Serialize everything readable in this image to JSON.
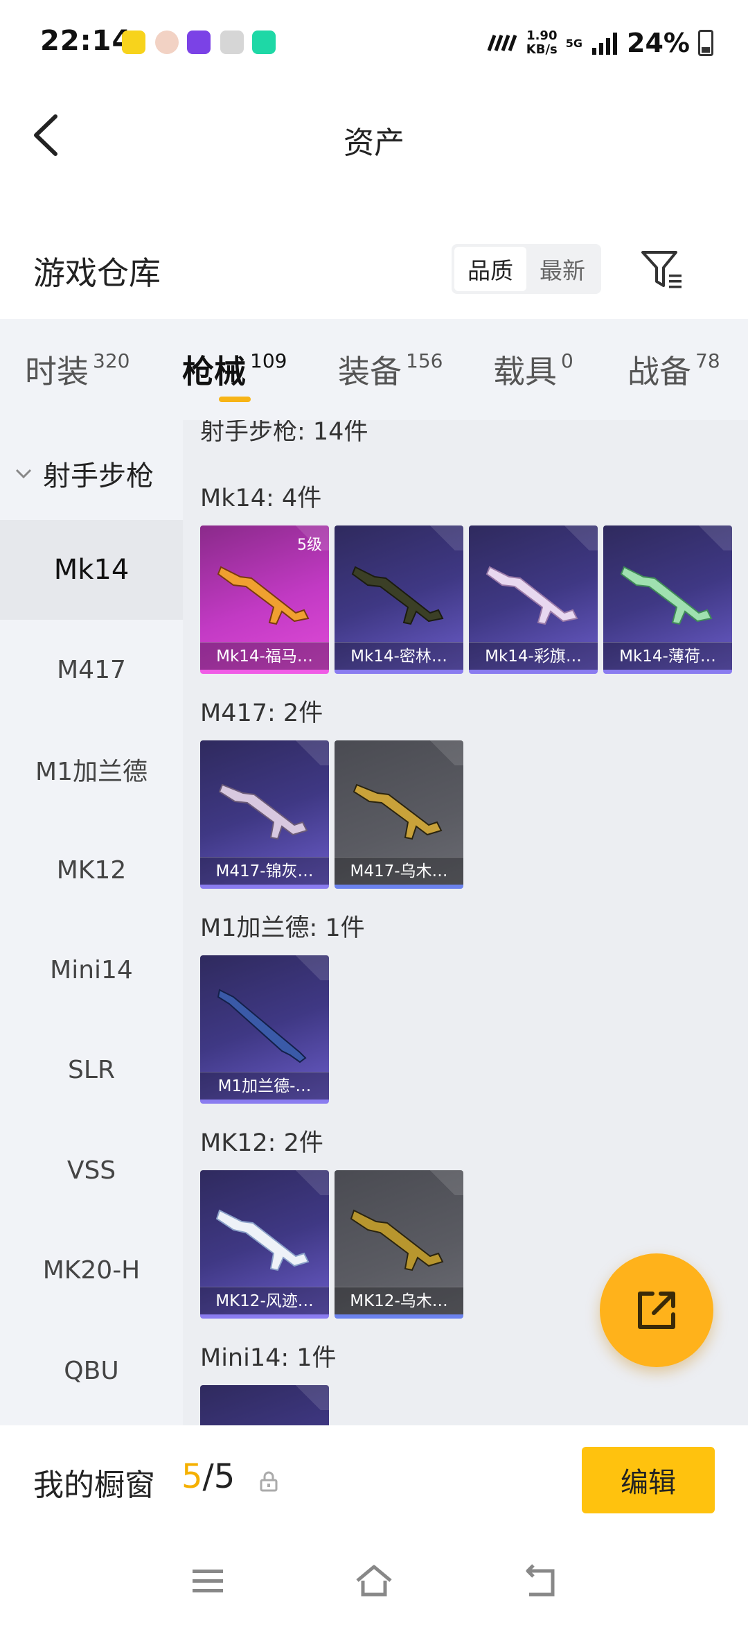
{
  "status": {
    "time": "22:14",
    "speed_top": "1.90",
    "speed_unit": "KB/s",
    "network": "5G",
    "battery": "24%"
  },
  "header": {
    "title": "资产"
  },
  "warehouse": {
    "title": "游戏仓库",
    "sort_quality": "品质",
    "sort_newest": "最新"
  },
  "tabs": [
    {
      "label": "时装",
      "count": "320"
    },
    {
      "label": "枪械",
      "count": "109"
    },
    {
      "label": "装备",
      "count": "156"
    },
    {
      "label": "载具",
      "count": "0"
    },
    {
      "label": "战备",
      "count": "78"
    }
  ],
  "sidebar": {
    "group": "射手步枪",
    "items": [
      "Mk14",
      "M417",
      "M1加兰德",
      "MK12",
      "Mini14",
      "SLR",
      "VSS",
      "MK20-H",
      "QBU"
    ]
  },
  "content": {
    "partial_header": "射手步枪: 14件",
    "sections": [
      {
        "label": "Mk14: 4件",
        "items": [
          {
            "name": "Mk14-福马…",
            "level": "5级",
            "tier": "pink"
          },
          {
            "name": "Mk14-密林…",
            "tier": "purple"
          },
          {
            "name": "Mk14-彩旗…",
            "tier": "purple"
          },
          {
            "name": "Mk14-薄荷…",
            "tier": "purple"
          }
        ]
      },
      {
        "label": "M417: 2件",
        "items": [
          {
            "name": "M417-锦灰…",
            "tier": "purple"
          },
          {
            "name": "M417-乌木…",
            "tier": "gray"
          }
        ]
      },
      {
        "label": "M1加兰德: 1件",
        "items": [
          {
            "name": "M1加兰德-…",
            "tier": "purple"
          }
        ]
      },
      {
        "label": "MK12: 2件",
        "items": [
          {
            "name": "MK12-风迹…",
            "tier": "purple"
          },
          {
            "name": "MK12-乌木…",
            "tier": "gray"
          }
        ]
      },
      {
        "label": "Mini14: 1件",
        "items": []
      }
    ]
  },
  "showcase": {
    "label": "我的橱窗",
    "current": "5",
    "separator": "/",
    "total": "5",
    "edit": "编辑"
  },
  "colors": {
    "accent": "#ffc20e",
    "tab_indicator": "#f7b416",
    "fab": "#ffb21b"
  }
}
